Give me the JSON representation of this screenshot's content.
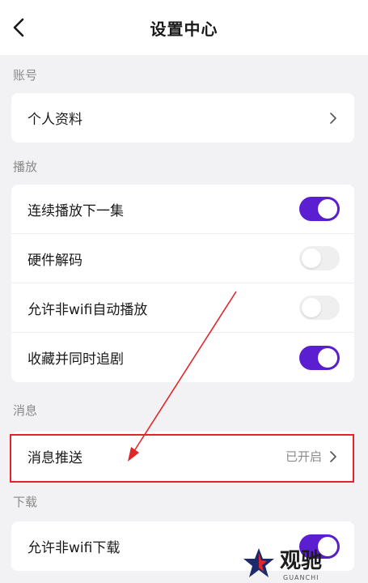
{
  "header": {
    "title": "设置中心",
    "back_icon": "chevron-left-icon"
  },
  "sections": [
    {
      "label": "账号",
      "rows": [
        {
          "label": "个人资料",
          "type": "link"
        }
      ]
    },
    {
      "label": "播放",
      "rows": [
        {
          "label": "连续播放下一集",
          "type": "toggle",
          "on": true
        },
        {
          "label": "硬件解码",
          "type": "toggle",
          "on": false
        },
        {
          "label": "允许非wifi自动播放",
          "type": "toggle",
          "on": false
        },
        {
          "label": "收藏并同时追剧",
          "type": "toggle",
          "on": true
        }
      ]
    },
    {
      "label": "消息",
      "rows": [
        {
          "label": "消息推送",
          "type": "link",
          "value": "已开启"
        }
      ]
    },
    {
      "label": "下载",
      "rows": [
        {
          "label": "允许非wifi下载",
          "type": "toggle",
          "on": true
        }
      ]
    }
  ],
  "colors": {
    "accent": "#5b1fd1",
    "annotation": "#e0262b",
    "background": "#f2f2f4"
  },
  "watermark": {
    "text": "观驰",
    "sub": "GUANCHI",
    "icon": "star-logo-icon"
  }
}
